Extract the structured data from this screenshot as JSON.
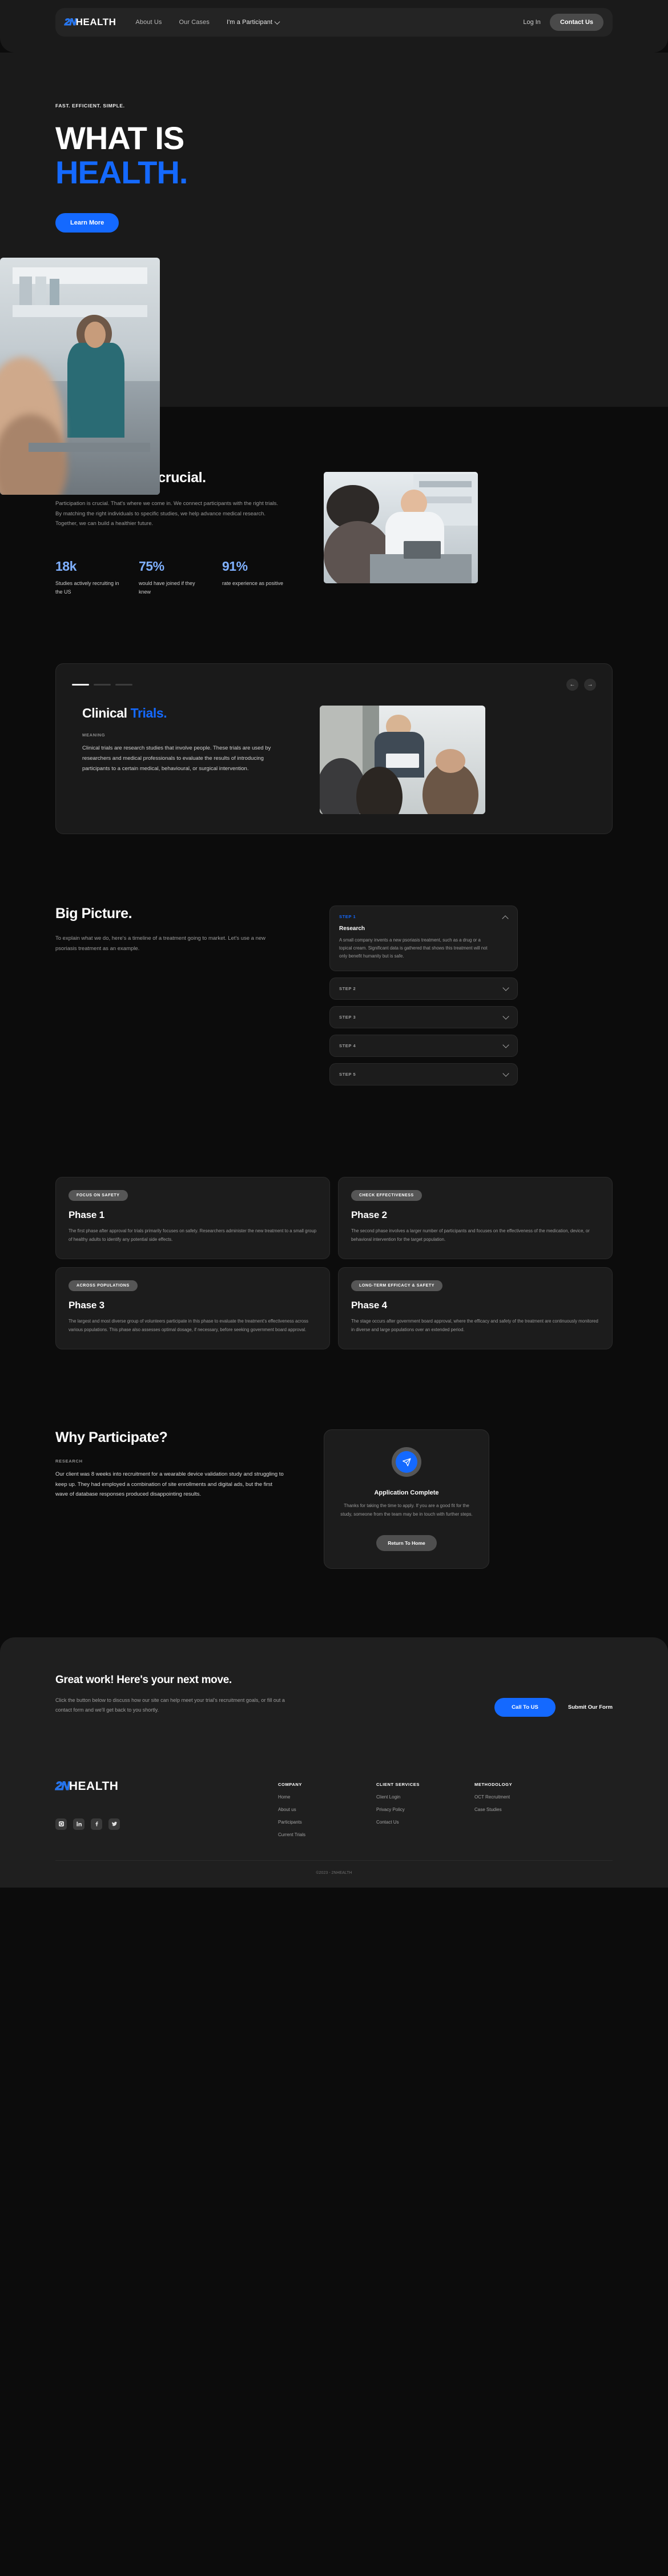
{
  "brand": {
    "mark": "2N",
    "word": "HEALTH"
  },
  "nav": {
    "links": [
      {
        "label": "About Us",
        "strong": false
      },
      {
        "label": "Our Cases",
        "strong": false
      },
      {
        "label": "I'm a Participant",
        "strong": true
      }
    ],
    "login_label": "Log In",
    "contact_label": "Contact Us"
  },
  "hero": {
    "eyebrow": "FAST. EFFICIENT. SIMPLE.",
    "title_line1": "WHAT IS",
    "title_line2": "HEALTH.",
    "cta_label": "Learn More"
  },
  "participation": {
    "heading": "Participation is crucial.",
    "paragraph": "Participation is crucial. That's where we come in. We connect participants with the right trials. By matching the right individuals to specific studies, we help advance medical research. Together, we can build a healthier future.",
    "stats": [
      {
        "value": "18k",
        "label": "Studies actively recruiting in the US"
      },
      {
        "value": "75%",
        "label": "would have joined if they knew"
      },
      {
        "value": "91%",
        "label": "rate experience as positive"
      }
    ]
  },
  "trials": {
    "dots_total": 3,
    "dots_active": 0,
    "prev_label": "←",
    "next_label": "→",
    "title_white": "Clinical ",
    "title_accent": "Trials.",
    "kicker": "MEANING",
    "paragraph": "Clinical trials are research studies that involve people. These trials are used by researchers and medical professionals to evaluate the results of introducing participants to a certain medical, behavioural, or surgical intervention."
  },
  "bigpicture": {
    "heading": "Big Picture.",
    "paragraph": "To explain what we do, here's a timeline of a treatment going to market. Let's use a new psoriasis treatment as an example.",
    "steps": [
      {
        "step": "STEP 1",
        "title": "Research",
        "text": "A small company invents a new psoriasis treatment, such as a drug or a topical cream. Significant data is gathered that shows this treatment will not only benefit humanity but is safe.",
        "open": true
      },
      {
        "step": "STEP 2",
        "title": "",
        "text": "",
        "open": false
      },
      {
        "step": "STEP 3",
        "title": "",
        "text": "",
        "open": false
      },
      {
        "step": "STEP 4",
        "title": "",
        "text": "",
        "open": false
      },
      {
        "step": "STEP 5",
        "title": "",
        "text": "",
        "open": false
      }
    ]
  },
  "phases": [
    {
      "chip": "FOCUS ON SAFETY",
      "title": "Phase 1",
      "text": "The first phase after approval for trials primarily focuses on safety. Researchers administer the new treatment to a small group of healthy adults to identify any potential side effects."
    },
    {
      "chip": "CHECK EFFECTIVENESS",
      "title": "Phase 2",
      "text": "The second phase involves a larger number of participants and focuses on the effectiveness of the medication, device, or behavioral intervention for the target population."
    },
    {
      "chip": "ACROSS POPULATIONS",
      "title": "Phase 3",
      "text": "The largest and most diverse group of volunteers participate in this phase to evaluate the treatment's effectiveness across various populations. This phase also assesses optimal dosage, if necessary, before seeking government board approval."
    },
    {
      "chip": "LONG-TERM EFFICACY & SAFETY",
      "title": "Phase 4",
      "text": "The stage occurs after government board approval, where the efficacy and safety of the treatment are continuously monitored in diverse and large populations over an extended period."
    }
  ],
  "why": {
    "heading": "Why Participate?",
    "kicker": "RESEARCH",
    "text": "Our client was 8 weeks into recruitment for a wearable device validation study and struggling to keep up. They had employed a combination of site enrollments and digital ads, but the first wave of database responses produced disappointing results.",
    "card": {
      "icon": "send-icon",
      "title": "Application Complete",
      "text": "Thanks for taking the time to apply. If you are a good fit for the study, someone from the team may be in touch with further steps.",
      "button_label": "Return To Home"
    }
  },
  "cta": {
    "heading": "Great work! Here's your next move.",
    "paragraph": "Click the button below to discuss how our site can help meet your trial's recruitment goals, or fill out a contact form and we'll get back to you shortly.",
    "primary_label": "Call To US",
    "secondary_label": "Submit Our Form"
  },
  "footer": {
    "socials": [
      "instagram-icon",
      "linkedin-icon",
      "facebook-icon",
      "twitter-icon"
    ],
    "columns": [
      {
        "heading": "COMPANY",
        "links": [
          "Home",
          "About us",
          "Participants",
          "Current Trials"
        ]
      },
      {
        "heading": "CLIENT SERVICES",
        "links": [
          "Client Login",
          "Privacy Policy",
          "Contact Us"
        ]
      },
      {
        "heading": "METHODOLOGY",
        "links": [
          "OCT Recruitment",
          "Case Studies"
        ]
      }
    ],
    "copyright": "©2023 - 2NHEALTH"
  },
  "colors": {
    "accent": "#1469ff",
    "bg": "#0c0c0c",
    "panel": "#1a1a1a",
    "card": "#1c1c1c"
  }
}
